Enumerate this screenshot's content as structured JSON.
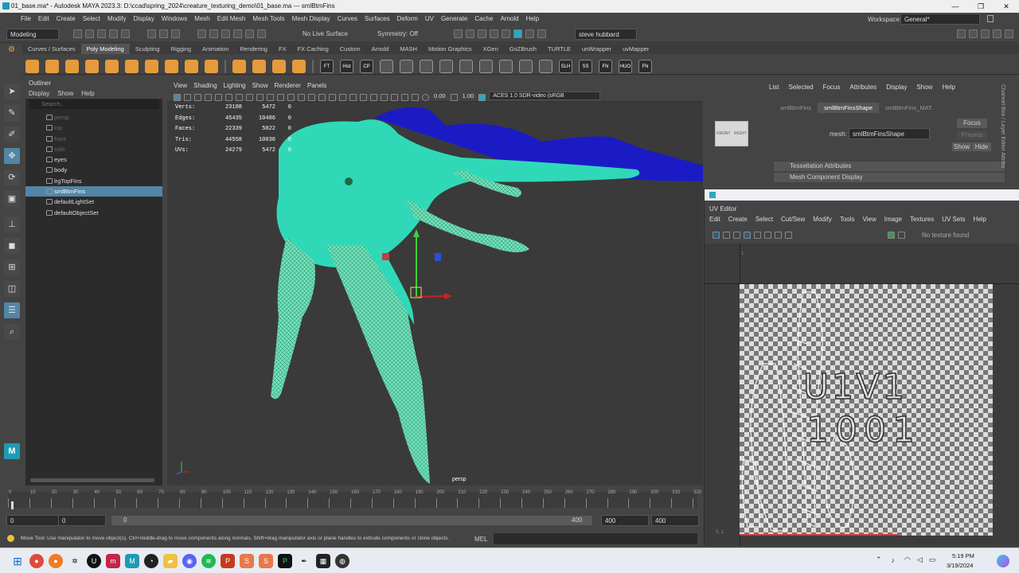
{
  "window": {
    "title": "01_base.ma* - Autodesk MAYA 2023.3: D:\\ccad\\spring_2024\\creature_texturing_demo\\01_base.ma  ---  smlBtmFins",
    "controls": [
      "—",
      "❐",
      "✕"
    ]
  },
  "menubar": {
    "items": [
      "File",
      "Edit",
      "Create",
      "Select",
      "Modify",
      "Display",
      "Windows",
      "Mesh",
      "Edit Mesh",
      "Mesh Tools",
      "Mesh Display",
      "Curves",
      "Surfaces",
      "Deform",
      "UV",
      "Generate",
      "Cache",
      "Arnold",
      "Help"
    ],
    "workspace_label": "Workspace:",
    "workspace_value": "General*"
  },
  "statusline": {
    "mode": "Modeling",
    "live_surface": "No Live Surface",
    "symmetry": "Symmetry: Off",
    "user": "steve hubbard"
  },
  "shelf": {
    "tabs": [
      "Curves / Surfaces",
      "Poly Modeling",
      "Sculpting",
      "Rigging",
      "Animation",
      "Rendering",
      "FX",
      "FX Caching",
      "Custom",
      "Arnold",
      "MASH",
      "Motion Graphics",
      "XGen",
      "GoZBrush",
      "TURTLE",
      "unWrapper",
      "uvMapper"
    ],
    "active_tab": "Poly Modeling",
    "labeled_icons": [
      "FT",
      "Hist",
      "CP",
      "SLH",
      "SS",
      "FN",
      "HUO",
      "FN"
    ]
  },
  "outliner": {
    "title": "Outliner",
    "menu": [
      "Display",
      "Show",
      "Help"
    ],
    "search_placeholder": "Search...",
    "items": [
      {
        "label": "persp",
        "dim": true
      },
      {
        "label": "top",
        "dim": true
      },
      {
        "label": "front",
        "dim": true
      },
      {
        "label": "side",
        "dim": true
      },
      {
        "label": "eyes",
        "dim": false
      },
      {
        "label": "body",
        "dim": false
      },
      {
        "label": "lrgTopFins",
        "dim": false
      },
      {
        "label": "smlBtmFins",
        "dim": false,
        "selected": true
      },
      {
        "label": "defaultLightSet",
        "dim": false
      },
      {
        "label": "defaultObjectSet",
        "dim": false
      }
    ]
  },
  "viewport": {
    "menu": [
      "View",
      "Shading",
      "Lighting",
      "Show",
      "Renderer",
      "Panels"
    ],
    "exposure": "0.00",
    "gamma": "1.00",
    "colorspace": "ACES 1.0 SDR-video (sRGB",
    "camera_label": "persp",
    "hud": [
      {
        "label": "Verts:",
        "a": "23108",
        "b": "5472",
        "c": "0"
      },
      {
        "label": "Edges:",
        "a": "45435",
        "b": "10486",
        "c": "0"
      },
      {
        "label": "Faces:",
        "a": "22339",
        "b": "5022",
        "c": "0"
      },
      {
        "label": "Tris:",
        "a": "44558",
        "b": "10030",
        "c": "0"
      },
      {
        "label": "UVs:",
        "a": "24279",
        "b": "5472",
        "c": "0"
      }
    ],
    "viewcube": [
      "FRONT",
      "RIGHT"
    ]
  },
  "channelbox": {
    "menu": [
      "List",
      "Selected",
      "Focus",
      "Attributes",
      "Display",
      "Show",
      "Help"
    ],
    "tabs": [
      "smlBtmFins",
      "smlBtmFinsShape",
      "smlBtmFins_MAT"
    ],
    "active_tab": "smlBtmFinsShape",
    "mesh_label": "mesh:",
    "mesh_value": "smlBtmFinsShape",
    "focus_btn": "Focus",
    "presets_btn": "Presets",
    "show_btn": "Show",
    "hide_btn": "Hide",
    "sections": [
      "Tessellation Attributes",
      "Mesh Component Display"
    ],
    "side_tabs": "Channel Box / Layer Editor   Attribu"
  },
  "uveditor": {
    "title": "UV Editor",
    "menu": [
      "Edit",
      "Create",
      "Select",
      "Cut/Sew",
      "Modify",
      "Tools",
      "View",
      "Image",
      "Textures",
      "UV Sets",
      "Help"
    ],
    "texture_label": "No texture found",
    "tile_label": "U1V1",
    "tile_number": "1001",
    "axis_top": "1",
    "axis_bottom": "0, 1"
  },
  "timeline": {
    "ticks": [
      "0",
      "10",
      "20",
      "30",
      "40",
      "50",
      "60",
      "70",
      "80",
      "90",
      "100",
      "110",
      "120",
      "130",
      "140",
      "150",
      "160",
      "170",
      "180",
      "190",
      "200",
      "210",
      "220",
      "230",
      "240",
      "250",
      "260",
      "270",
      "280",
      "290",
      "300",
      "310",
      "320"
    ],
    "range_start": "0",
    "range_start2": "0",
    "playback_start": "0",
    "playback_end": "400",
    "range_end": "400",
    "range_end2": "400"
  },
  "helpline": {
    "text": "Move Tool: Use manipulator to move object(s). Ctrl+middle-drag to move components along normals. Shift+drag manipulator axis or plane handles to extrude components or clone objects.",
    "mel": "MEL"
  },
  "taskbar": {
    "time": "5:19 PM",
    "date": "3/19/2024"
  }
}
